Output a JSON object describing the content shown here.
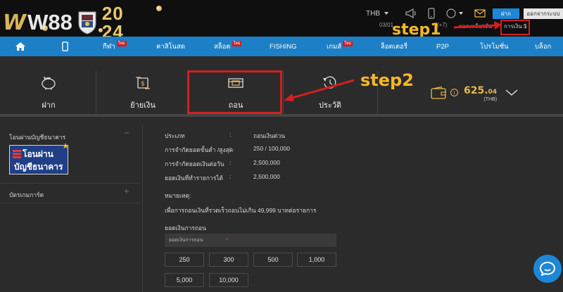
{
  "header": {
    "logo_text": "W88",
    "year_top": "20",
    "year_bottom": "24",
    "currency": "THB",
    "deposit_label": "ฝาก",
    "logout_label": "ออกจากระบบ",
    "datetime": "03/01",
    "timezone": "(+7)",
    "balance_link": "ยอดเหลือ/เติม",
    "finance_link": "การเงิน $"
  },
  "nav": {
    "items": [
      {
        "label": "",
        "icon": "home-icon"
      },
      {
        "label": "",
        "icon": "mobile-icon"
      },
      {
        "label": "กีฬา",
        "badge": "ใหม่"
      },
      {
        "label": "คาสิโนสด"
      },
      {
        "label": "สล็อต",
        "badge": "ใหม่"
      },
      {
        "label": "FISHING"
      },
      {
        "label": "เกมส์",
        "badge": "ใหม่"
      },
      {
        "label": "ล็อตเตอรี่"
      },
      {
        "label": "P2P"
      },
      {
        "label": "โปรโมชั่น"
      },
      {
        "label": "บล็อก"
      }
    ]
  },
  "annotations": {
    "step1": "step1",
    "step2": "step2",
    "box_color": "#d21f1f",
    "label_color": "#f4b826"
  },
  "actions": [
    {
      "label": "ฝาก",
      "icon": "piggy-bank-icon"
    },
    {
      "label": "ย้ายเงิน",
      "icon": "transfer-icon"
    },
    {
      "label": "ถอน",
      "icon": "withdraw-icon"
    },
    {
      "label": "ประวัติ",
      "icon": "history-icon"
    }
  ],
  "balance": {
    "amount_main": "625.",
    "amount_decimal": "04",
    "currency": "(THB)"
  },
  "sidebar": {
    "bank_title": "โอนผ่านบัญชีธนาคาร",
    "bank_logo_line1": "โอนผ่าน",
    "bank_logo_line2": "บัญชีธนาคาร",
    "bank_collapse": "−",
    "card_title": "บัตรเกมการ์ด",
    "card_expand": "+"
  },
  "withdraw": {
    "rows": [
      {
        "label": "ประเภท",
        "colon": ":",
        "value": "ถอนเงินด่วน"
      },
      {
        "label": "การจำกัดยอดขั้นต่ำ /สูงสุด",
        "colon": ":",
        "value": "250 / 100,000"
      },
      {
        "label": "การจำกัดยอดเงินต่อวัน",
        "colon": ":",
        "value": "2,500,000"
      },
      {
        "label": "ยอดเงินที่ทำรายการได้",
        "colon": ":",
        "value": "2,500,000"
      }
    ],
    "note_title": "หมายเหตุ:",
    "note_text": "เพื่อการถอนเงินที่รวดเร็วถอนไม่เกิน 49,999 บาทต่อรายการ",
    "amount_label": "ยอดเงินการถอน",
    "amount_required": "*",
    "amount_placeholder": "ยอดเงินการถอน",
    "quick_amounts": [
      "250",
      "300",
      "500",
      "1,000",
      "5,000",
      "10,000"
    ]
  },
  "colors": {
    "accent": "#1d7fc5",
    "gold": "#e8b84c"
  }
}
